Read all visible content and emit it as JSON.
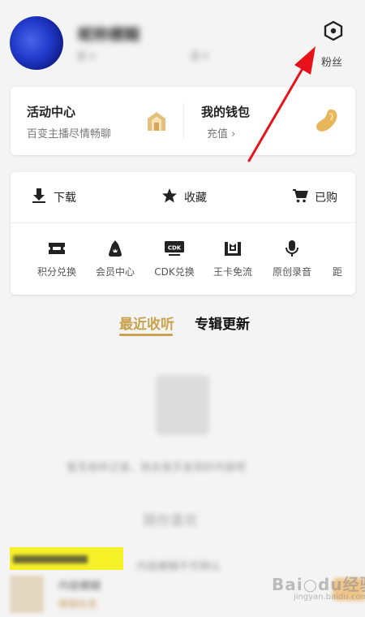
{
  "header": {
    "username": "昵称模糊",
    "stat_a": "0 •",
    "stat_b": "0 •",
    "fans_label": "粉丝",
    "settings_icon": "hexagon-settings-icon"
  },
  "activity_card": {
    "title": "活动中心",
    "subtitle": "百变主播尽情畅聊",
    "icon": "house-icon"
  },
  "wallet_card": {
    "title": "我的钱包",
    "subtitle": "充值 ›",
    "icon": "bean-icon"
  },
  "quick_actions": [
    {
      "label": "下载",
      "icon": "download-icon"
    },
    {
      "label": "收藏",
      "icon": "star-icon"
    },
    {
      "label": "已购",
      "icon": "cart-icon"
    }
  ],
  "services": [
    {
      "label": "积分兑换",
      "icon": "ticket-icon"
    },
    {
      "label": "会员中心",
      "icon": "crown-bag-icon"
    },
    {
      "label": "CDK兑换",
      "icon": "cdk-icon"
    },
    {
      "label": "王卡免流",
      "icon": "king-card-icon"
    },
    {
      "label": "原创录音",
      "icon": "mic-icon"
    },
    {
      "label": "距",
      "icon": "partial-icon"
    }
  ],
  "tabs": {
    "active": "最近收听",
    "other": "专辑更新"
  },
  "colors": {
    "accent": "#c8a24d",
    "arrow": "#e8121b",
    "banner": "#f6f029"
  },
  "blurred": {
    "empty_text": "暂无收听记录，快去首页发现好内容吧",
    "heading": "猜你喜欢",
    "promo": "内容模糊不可辨认",
    "item_title": "内容模糊",
    "item_sub": "模糊信息"
  },
  "watermark": {
    "main": "Bai○du经验",
    "sub": "jingyan.baidu.com"
  }
}
